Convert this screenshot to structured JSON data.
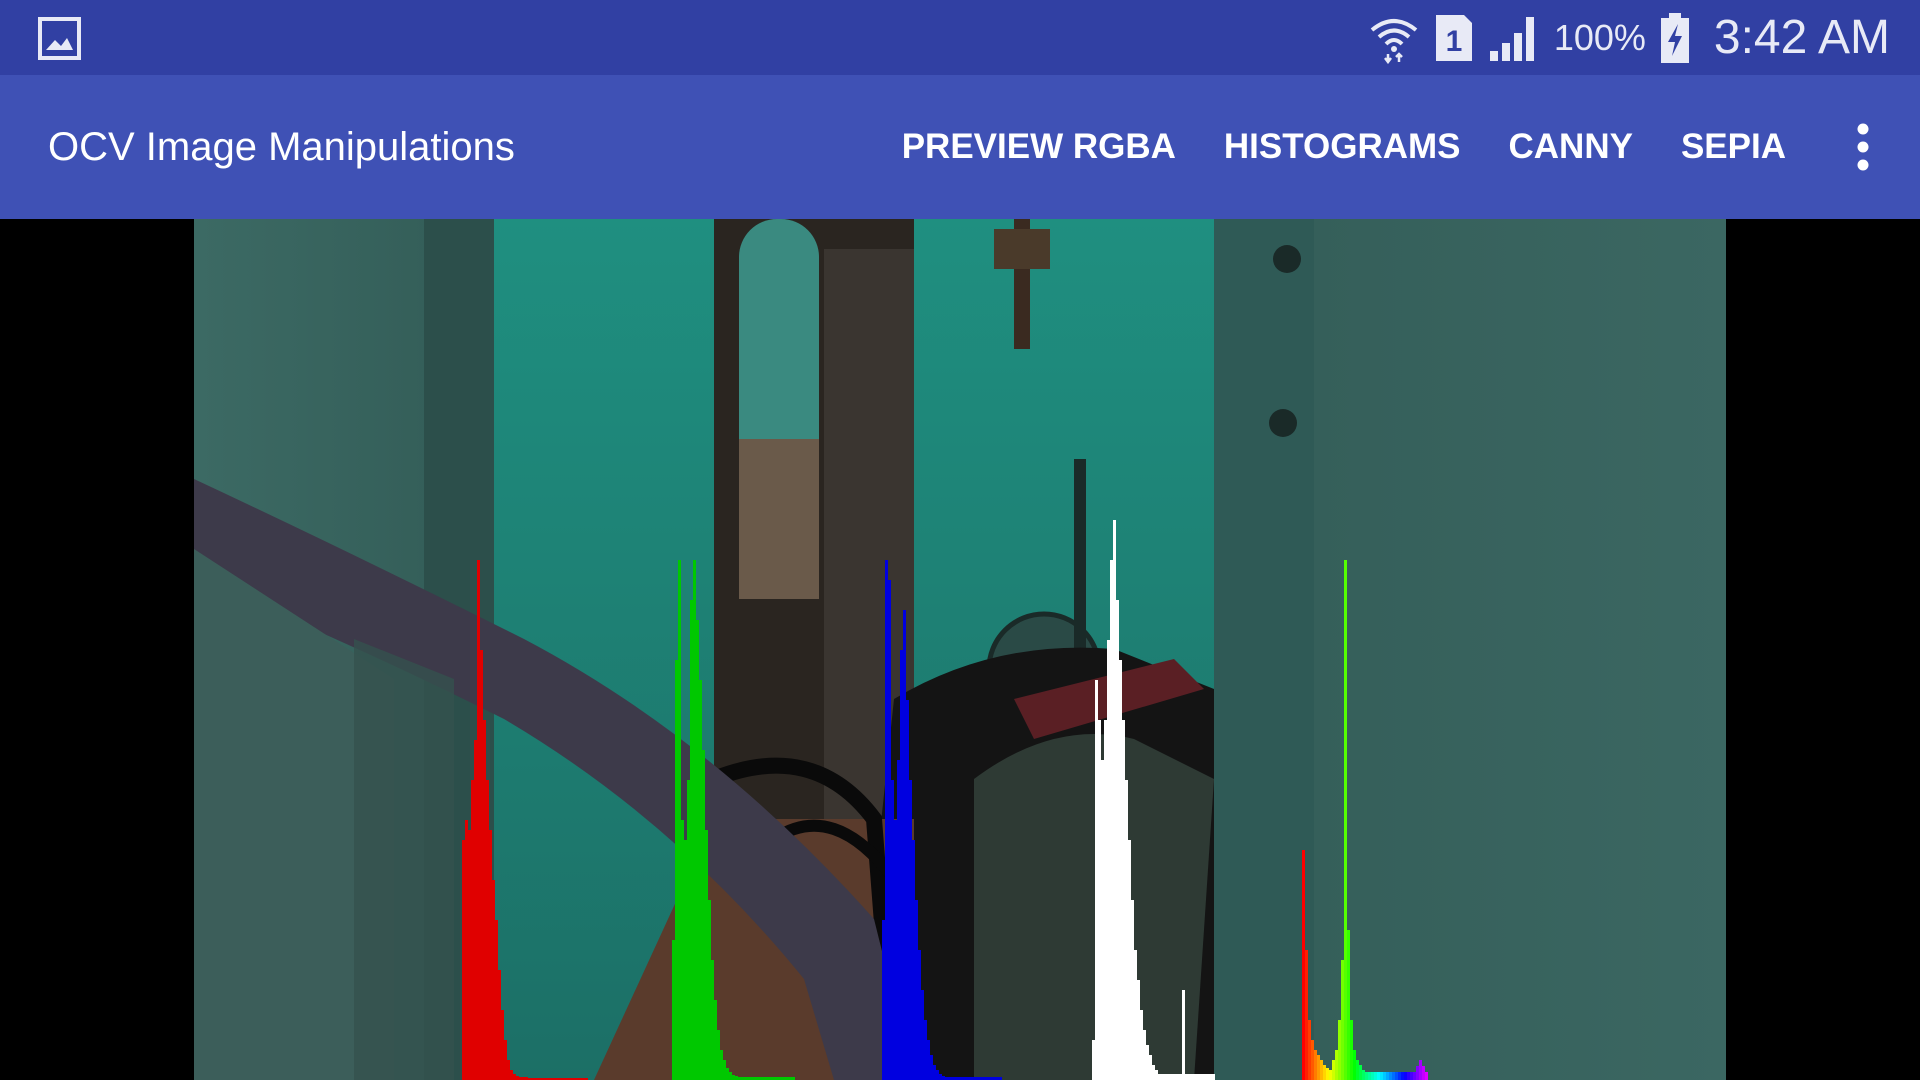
{
  "status_bar": {
    "notification_icon": "gallery-icon",
    "wifi_icon": "wifi-icon",
    "sim_label": "1",
    "signal_icon": "signal-icon",
    "battery_percent": "100%",
    "battery_icon": "battery-charging-icon",
    "time": "3:42 AM"
  },
  "action_bar": {
    "title": "OCV Image Manipulations",
    "menu": [
      {
        "label": "PREVIEW RGBA"
      },
      {
        "label": "HISTOGRAMS"
      },
      {
        "label": "CANNY"
      },
      {
        "label": "SEPIA"
      }
    ],
    "overflow_icon": "more-vert-icon"
  },
  "colors": {
    "status_bar": "#3140a3",
    "action_bar": "#3f51b5",
    "hist_red": "#e00000",
    "hist_green": "#00c800",
    "hist_blue": "#0000e0",
    "hist_luma": "#ffffff"
  }
}
